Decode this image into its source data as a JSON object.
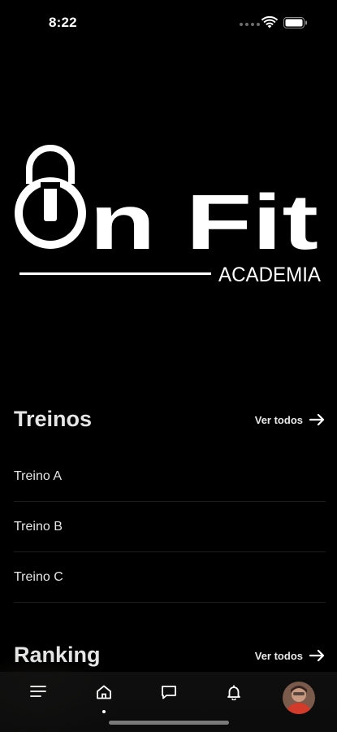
{
  "status_bar": {
    "time": "8:22",
    "icons": [
      "signal-dots-icon",
      "wifi-icon",
      "battery-icon"
    ]
  },
  "logo": {
    "brand_word": "n Fit",
    "sub": "ACADEMIA",
    "icon": "padlock-power-icon"
  },
  "workouts": {
    "title": "Treinos",
    "see_all": "Ver todos",
    "items": [
      {
        "label": "Treino A"
      },
      {
        "label": "Treino B"
      },
      {
        "label": "Treino C"
      }
    ]
  },
  "ranking": {
    "title": "Ranking",
    "see_all": "Ver todos"
  },
  "tab_bar": {
    "tabs": [
      {
        "icon": "menu-icon",
        "active": false
      },
      {
        "icon": "home-icon",
        "active": true
      },
      {
        "icon": "chat-icon",
        "active": false
      },
      {
        "icon": "bell-icon",
        "active": false
      },
      {
        "icon": "avatar",
        "active": false
      }
    ]
  },
  "colors": {
    "background": "#000000",
    "text": "#e6e6e6",
    "divider": "#1d1d1d"
  }
}
